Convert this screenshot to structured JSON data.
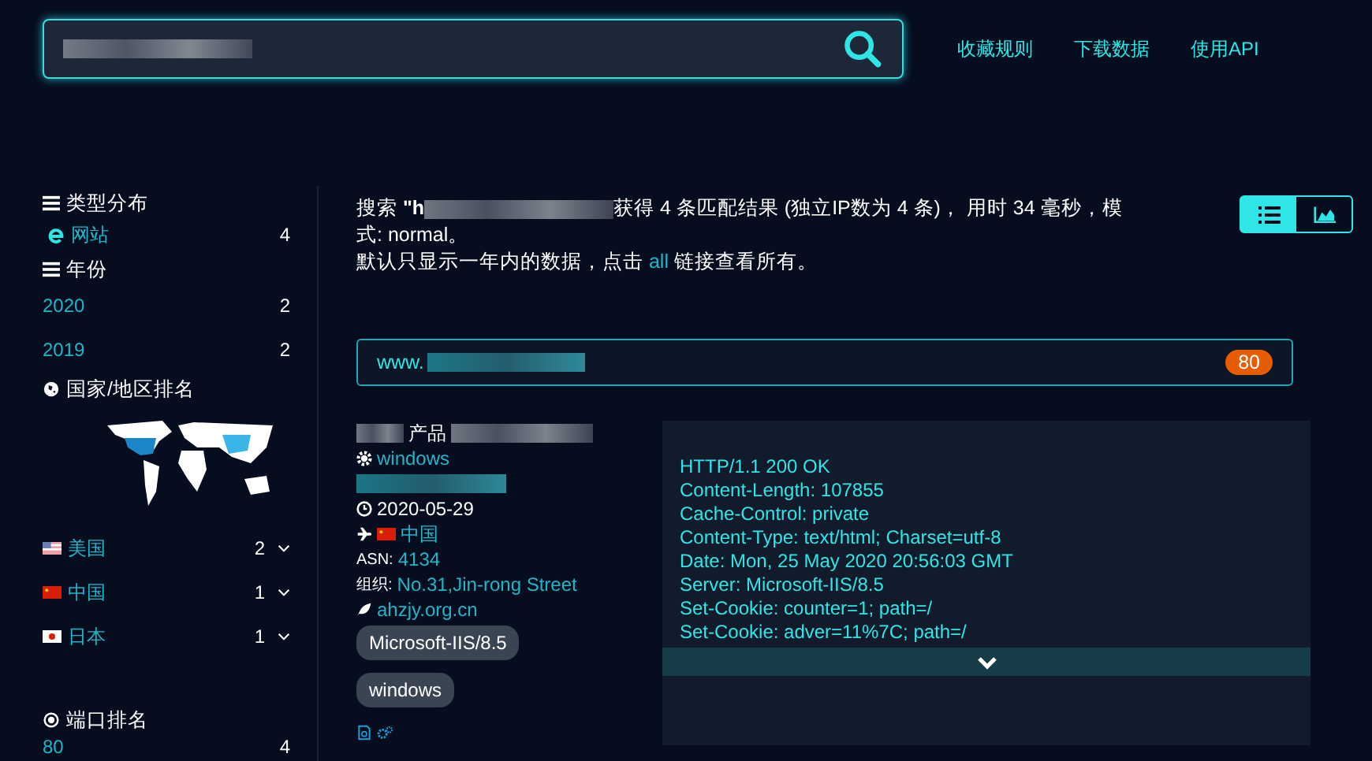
{
  "search": {
    "redacted": true
  },
  "nav_links": [
    "收藏规则",
    "下载数据",
    "使用API"
  ],
  "sidebar": {
    "type_section": {
      "title": "类型分布",
      "items": [
        {
          "label": "网站",
          "count": "4"
        }
      ]
    },
    "year_section": {
      "title": "年份",
      "items": [
        {
          "label": "2020",
          "count": "2"
        },
        {
          "label": "2019",
          "count": "2"
        }
      ]
    },
    "country_section": {
      "title": "国家/地区排名",
      "items": [
        {
          "kind": "us",
          "label": "美国",
          "count": "2"
        },
        {
          "kind": "cn",
          "label": "中国",
          "count": "1"
        },
        {
          "kind": "jp",
          "label": "日本",
          "count": "1"
        }
      ]
    },
    "port_section": {
      "title": "端口排名",
      "items": [
        {
          "label": "80",
          "count": "4"
        }
      ]
    }
  },
  "summary": {
    "prefix": "搜索 **\"h**",
    "suffix_lines": [
      "获得 4 条匹配结果 (独立IP数为 4 条)， 用时 34 毫秒，模",
      "式: normal。"
    ],
    "note_before": "默认只显示一年内的数据，点击",
    "link": "all",
    "note_after": "链接查看所有。"
  },
  "view_toggle": [
    {
      "kind": "list",
      "selected": true
    },
    {
      "kind": "chart",
      "selected": false
    }
  ],
  "result": {
    "host_prefix": "www.",
    "port": "80",
    "title_visible": "产品",
    "os": "windows",
    "date": "2020-05-29",
    "country": "中国",
    "asn_label": "ASN:",
    "asn": "4134",
    "org_label": "组织:",
    "org": "No.31,Jin-rong Street",
    "domain": "ahzjy.org.cn",
    "tags": [
      "Microsoft-IIS/8.5",
      "windows"
    ],
    "headers": [
      "HTTP/1.1 200 OK",
      "Content-Length: 107855",
      "Cache-Control: private",
      "Content-Type: text/html; Charset=utf-8",
      "Date: Mon, 25 May 2020 20:56:03 GMT",
      "Server: Microsoft-IIS/8.5",
      "Set-Cookie: counter=1; path=/",
      "Set-Cookie: adver=11%7C; path=/"
    ]
  }
}
